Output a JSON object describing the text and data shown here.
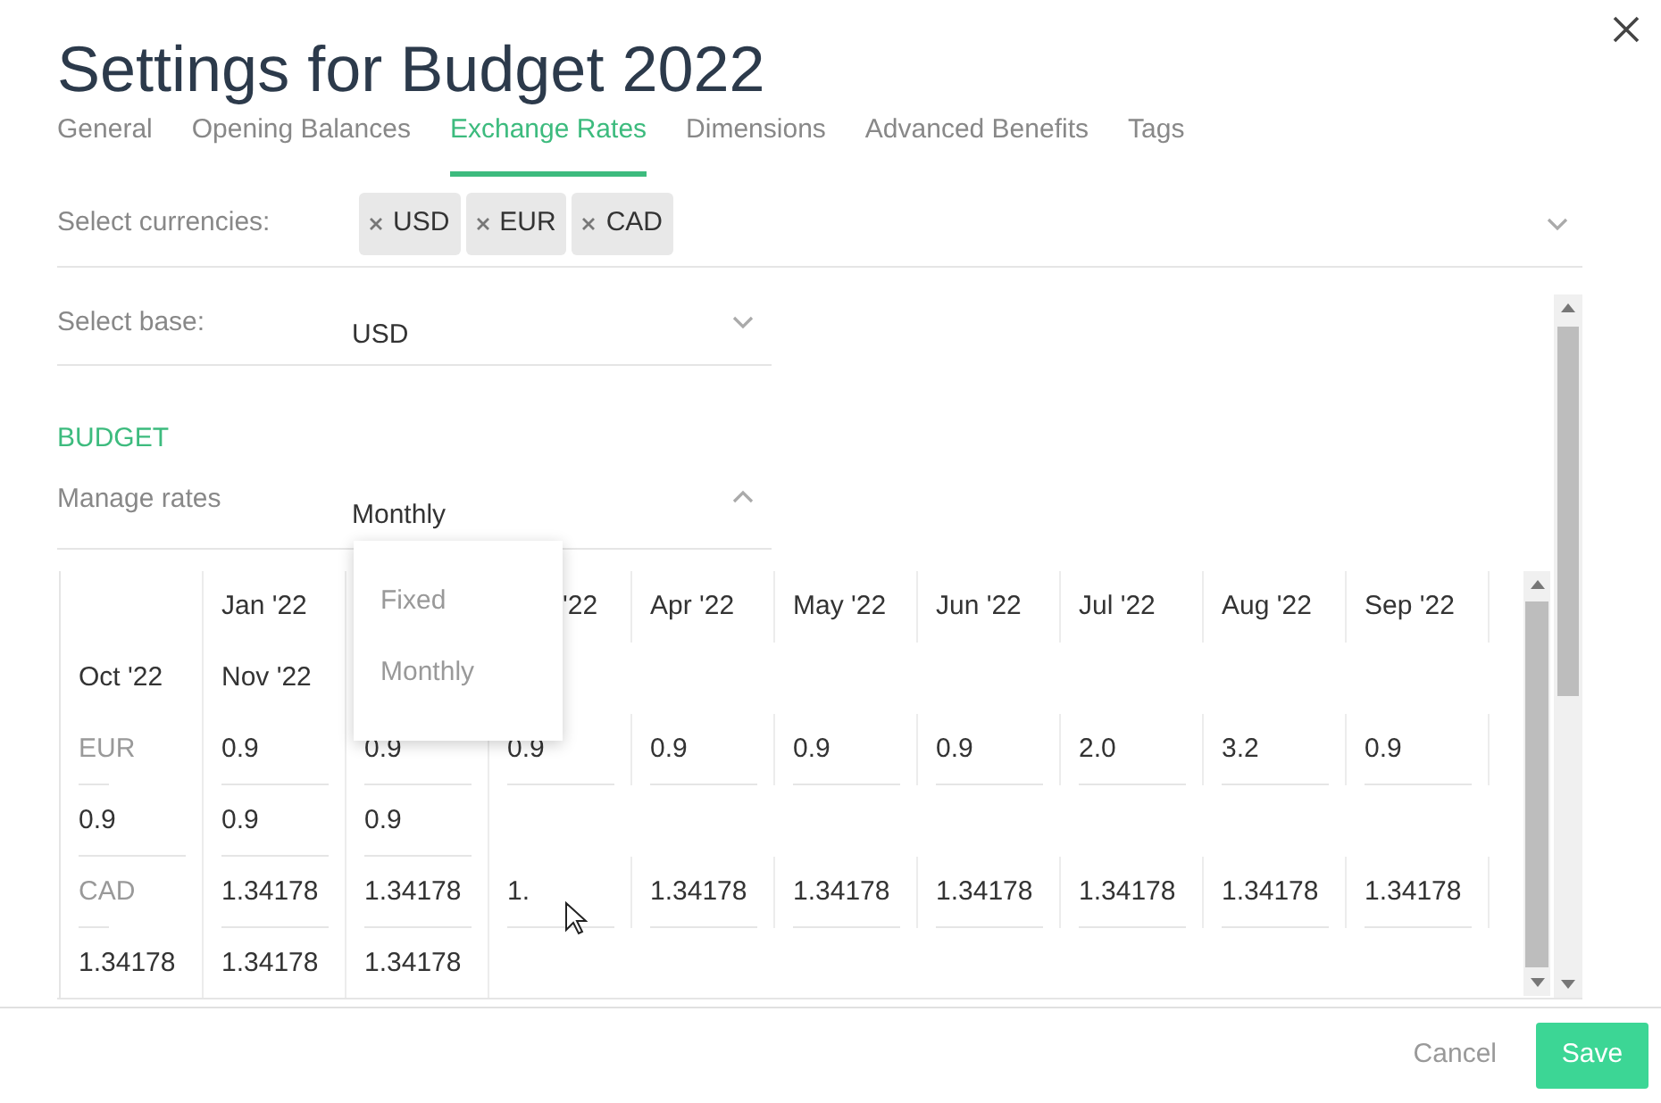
{
  "dialog": {
    "title": "Settings for Budget 2022"
  },
  "tabs": [
    {
      "label": "General",
      "selected": false
    },
    {
      "label": "Opening Balances",
      "selected": false
    },
    {
      "label": "Exchange Rates",
      "selected": true
    },
    {
      "label": "Dimensions",
      "selected": false
    },
    {
      "label": "Advanced Benefits",
      "selected": false
    },
    {
      "label": "Tags",
      "selected": false
    }
  ],
  "currencies": {
    "label": "Select currencies:",
    "tags": [
      "USD",
      "EUR",
      "CAD"
    ]
  },
  "base": {
    "label": "Select base:",
    "value": "USD"
  },
  "section_heading": "BUDGET",
  "manage_rates": {
    "label": "Manage rates",
    "value": "Monthly",
    "expanded": true,
    "options": [
      "Fixed",
      "Monthly"
    ]
  },
  "table": {
    "columns": [
      {
        "label": "Jan '22",
        "covered": false
      },
      {},
      {
        "label": "'22",
        "covered": true
      },
      {
        "label": "Apr '22",
        "covered": false
      },
      {
        "label": "May '22",
        "covered": false
      },
      {
        "label": "Jun '22",
        "covered": false
      },
      {
        "label": "Jul '22",
        "covered": false
      },
      {
        "label": "Aug '22",
        "covered": false
      },
      {
        "label": "Sep '22",
        "covered": false
      },
      {
        "label": "Oct '22",
        "covered": false
      },
      {
        "label": "Nov '22",
        "covered": false
      },
      {}
    ],
    "rows": [
      {
        "currency": "EUR",
        "values": [
          "0.9",
          "0.9",
          "0.9",
          "0.9",
          "0.9",
          "0.9",
          "2.0",
          "3.2",
          "0.9",
          "0.9",
          "0.9",
          "0.9"
        ]
      },
      {
        "currency": "CAD",
        "values": [
          "1.34178",
          "1.34178",
          "1.",
          "1.34178",
          "1.34178",
          "1.34178",
          "1.34178",
          "1.34178",
          "1.34178",
          "1.34178",
          "1.34178",
          "1.34178"
        ]
      }
    ]
  },
  "footer": {
    "cancel": "Cancel",
    "save": "Save"
  }
}
